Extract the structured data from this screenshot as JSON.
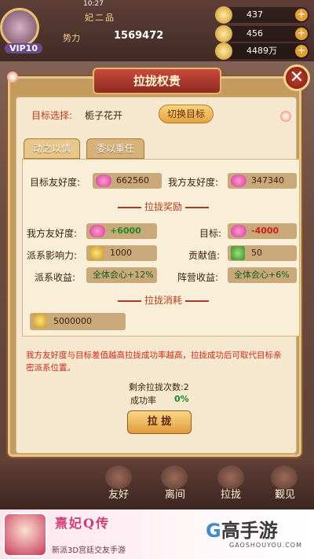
{
  "status": {
    "time": "10:27"
  },
  "player": {
    "name": "妃二品",
    "power_label": "势力",
    "power_value": "1569472",
    "vip": "VIP10"
  },
  "resources": [
    {
      "icon": "ingot-icon",
      "value": "437"
    },
    {
      "icon": "silver-icon",
      "value": "456"
    },
    {
      "icon": "coin-icon",
      "value": "4489万"
    }
  ],
  "dialog": {
    "title": "拉拢权贵",
    "close_label": "✕",
    "target_label": "目标选择:",
    "target_name": "栀子花开",
    "switch_button": "切换目标",
    "tabs": [
      "动之以情",
      "委以重任"
    ],
    "target_favor_label": "目标友好度:",
    "target_favor_value": "662560",
    "my_favor_label": "我方友好度:",
    "my_favor_value": "347340",
    "reward_title": "拉拢奖励",
    "reward_my_favor_label": "我方友好度:",
    "reward_my_favor_value": "+6000",
    "reward_target_label": "目标:",
    "reward_target_value": "-4000",
    "influence_label": "派系影响力:",
    "influence_value": "1000",
    "contribution_label": "贡献值:",
    "contribution_value": "50",
    "faction_income_label": "派系收益:",
    "faction_income_value": "全体会心+12%",
    "camp_income_label": "阵营收益:",
    "camp_income_value": "全体会心+6%",
    "cost_title": "拉拢消耗",
    "cost_value": "5000000",
    "description": "我方友好度与目标差值越高拉拢成功率越高，拉拢成功后可取代目标亲密派系位置。",
    "remaining_label": "剩余拉拢次数:2",
    "success_rate_label": "成功率",
    "success_rate_value": "0%",
    "recruit_button": "拉 拢"
  },
  "bottom_menu": [
    "友好",
    "离间",
    "拉拢",
    "觐见"
  ],
  "ad": {
    "game_logo": "熹妃Q传",
    "tagline": "新派3D宫廷交友手游",
    "site_brand": "高手游",
    "site_url": "GAOSHOUYOU.COM"
  }
}
